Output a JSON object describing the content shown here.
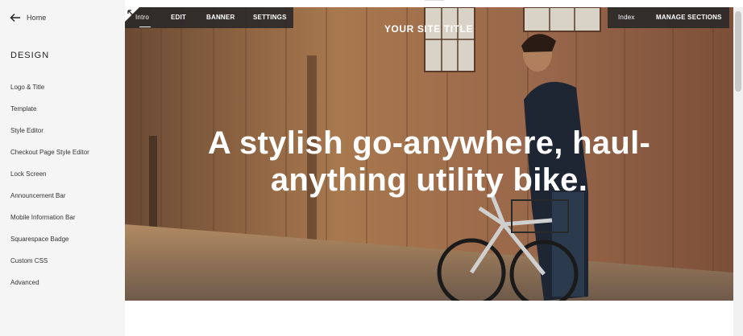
{
  "sidebar": {
    "back_label": "Home",
    "section_title": "DESIGN",
    "items": [
      {
        "label": "Logo & Title"
      },
      {
        "label": "Template"
      },
      {
        "label": "Style Editor"
      },
      {
        "label": "Checkout Page Style Editor"
      },
      {
        "label": "Lock Screen"
      },
      {
        "label": "Announcement Bar"
      },
      {
        "label": "Mobile Information Bar"
      },
      {
        "label": "Squarespace Badge"
      },
      {
        "label": "Custom CSS"
      },
      {
        "label": "Advanced"
      }
    ]
  },
  "toolbar": {
    "intro": "Intro",
    "edit": "EDIT",
    "banner": "BANNER",
    "settings": "SETTINGS",
    "index": "Index",
    "manage_sections": "MANAGE SECTIONS"
  },
  "hero": {
    "site_title": "YOUR SITE TITLE",
    "headline_line1": "A stylish go-anywhere, haul-",
    "headline_line2": "anything utility bike."
  },
  "icons": {
    "back": "arrow-left-icon",
    "corner": "arrow-up-left-icon"
  }
}
